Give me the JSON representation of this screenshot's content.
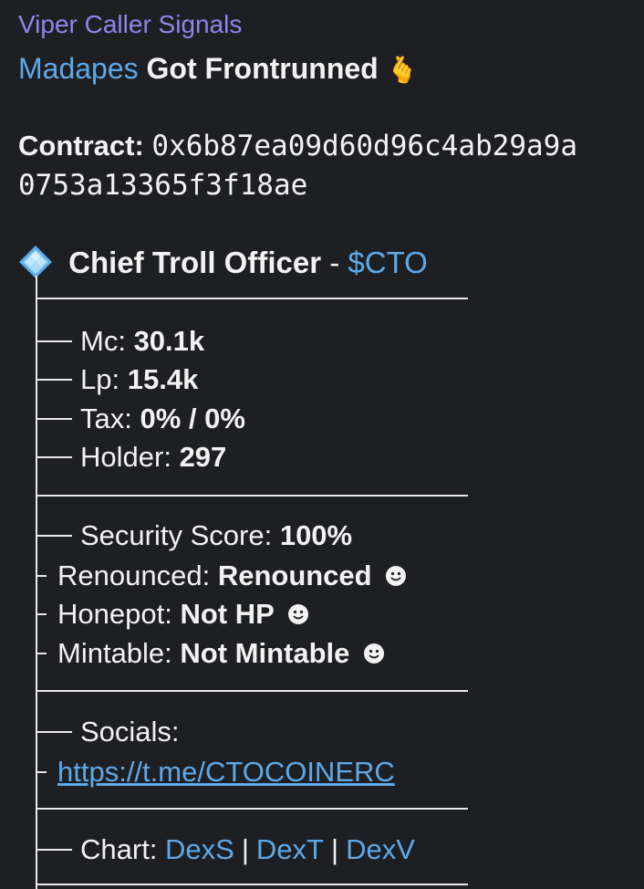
{
  "message": {
    "sender": "Viper Caller Signals",
    "headline": {
      "mention": "Madapes",
      "text": "Got Frontrunned",
      "emoji": "🫰"
    },
    "contract": {
      "label": "Contract:",
      "line1": "0x6b87ea09d60d96c4ab29a9a",
      "line2": "0753a13365f3f18ae"
    },
    "token": {
      "icon": "diamond-emoji-icon",
      "name": "Chief Troll Officer",
      "separator": "-",
      "ticker": "$CTO"
    },
    "stats": {
      "mc_label": "Mc:",
      "mc_value": "30.1k",
      "lp_label": "Lp:",
      "lp_value": "15.4k",
      "tax_label": "Tax:",
      "tax_value": "0% / 0%",
      "holder_label": "Holder:",
      "holder_value": "297"
    },
    "security": {
      "score_label": "Security Score:",
      "score_value": "100%",
      "renounced_label": "Renounced:",
      "renounced_value": "Renounced",
      "honeypot_label": "Honepot:",
      "honeypot_value": "Not HP",
      "mintable_label": "Mintable:",
      "mintable_value": "Not Mintable"
    },
    "socials": {
      "label": "Socials:",
      "telegram_url": "https://t.me/CTOCOINERC"
    },
    "chart": {
      "label": "Chart:",
      "links": [
        "DexS",
        "DexT",
        "DexV"
      ],
      "separator": "|"
    }
  },
  "colors": {
    "background": "#1e1f23",
    "sender": "#8e86ea",
    "link": "#5ea9e8",
    "text": "#f2f2f2",
    "tree_lines": "#e8e8e8"
  }
}
